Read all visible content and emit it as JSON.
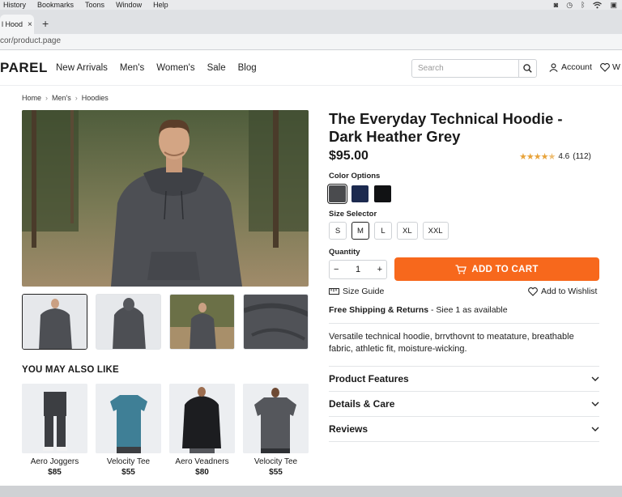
{
  "os_menu": {
    "items": [
      "History",
      "Bookmarks",
      "Toons",
      "Window",
      "Help"
    ]
  },
  "browser": {
    "tab_title": "l Hood",
    "url": "cor/product.page"
  },
  "site": {
    "logo": "PAREL",
    "nav": [
      "New Arrivals",
      "Men's",
      "Women's",
      "Sale",
      "Blog"
    ],
    "search_placeholder": "Search",
    "account_label": "Account",
    "wishlist_short": "W"
  },
  "breadcrumb": [
    "Home",
    "Men's",
    "Hoodies"
  ],
  "product": {
    "title_line1": "The Everyday Technical Hoodie -",
    "title_line2": "Dark Heather Grey",
    "price": "$95.00",
    "rating": "4.6",
    "rating_stars": 4.6,
    "review_count": "(112)",
    "color_label": "Color Options",
    "colors": [
      "#4a4b4e",
      "#1c2a4f",
      "#111214"
    ],
    "size_label": "Size Selector",
    "sizes": [
      "S",
      "M",
      "L",
      "XL",
      "XXL"
    ],
    "selected_size": "M",
    "quantity_label": "Quantity",
    "quantity": "1",
    "add_to_cart": "ADD TO CART",
    "size_guide": "Size Guide",
    "add_to_wishlist": "Add to Wishlist",
    "shipping_bold": "Free Shipping & Returns",
    "shipping_rest": " - Siee 1 as available",
    "description": "Versatile technical hoodie, brrvthovnt to meatature, breathable fabric, athletic fit, moisture-wicking.",
    "accordions": [
      "Product Features",
      "Details & Care",
      "Reviews"
    ],
    "accent": "#f7681c",
    "star_color": "#e8a33a"
  },
  "recommendations": {
    "heading": "YOU MAY ALSO LIKE",
    "items": [
      {
        "name": "Aero Joggers",
        "price": "$85"
      },
      {
        "name": "Velocity Tee",
        "price": "$55"
      },
      {
        "name": "Aero Veadners",
        "price": "$80"
      },
      {
        "name": "Velocity Tee",
        "price": "$55"
      }
    ]
  }
}
